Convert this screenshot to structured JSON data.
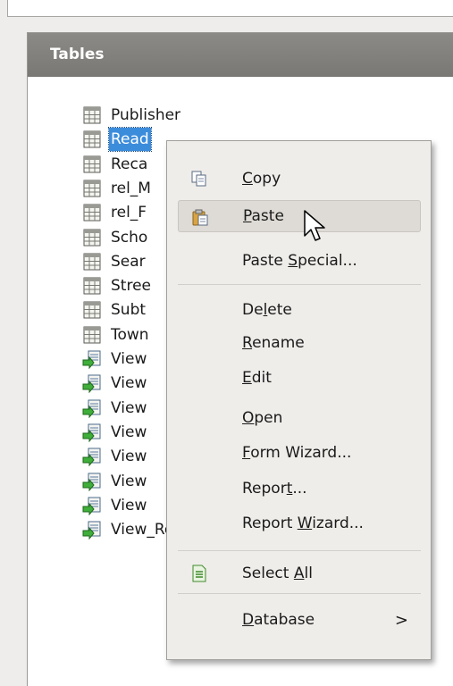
{
  "panel": {
    "title": "Tables"
  },
  "tree_items": [
    {
      "label": "Publisher",
      "kind": "table"
    },
    {
      "label": "Read",
      "kind": "table",
      "selected": true
    },
    {
      "label": "Reca",
      "kind": "table"
    },
    {
      "label": "rel_M",
      "kind": "table"
    },
    {
      "label": "rel_F",
      "kind": "table"
    },
    {
      "label": "Scho",
      "kind": "table"
    },
    {
      "label": "Sear",
      "kind": "table"
    },
    {
      "label": "Stree",
      "kind": "table"
    },
    {
      "label": "Subt",
      "kind": "table"
    },
    {
      "label": "Town",
      "kind": "table"
    },
    {
      "label": "View",
      "kind": "view"
    },
    {
      "label": "View",
      "kind": "view"
    },
    {
      "label": "View",
      "kind": "view"
    },
    {
      "label": "View",
      "kind": "view"
    },
    {
      "label": "View",
      "kind": "view"
    },
    {
      "label": "View",
      "kind": "view"
    },
    {
      "label": "View",
      "kind": "view"
    },
    {
      "label": "View_Recall_current",
      "kind": "view"
    }
  ],
  "context_menu": {
    "items": [
      {
        "pre": "",
        "key": "C",
        "post": "opy",
        "icon": "copy-icon"
      },
      {
        "pre": "",
        "key": "P",
        "post": "aste",
        "icon": "paste-icon",
        "hover": true
      },
      {
        "pre": "Paste ",
        "key": "S",
        "post": "pecial...",
        "icon": ""
      },
      {
        "pre": "De",
        "key": "l",
        "post": "ete",
        "icon": ""
      },
      {
        "pre": "",
        "key": "R",
        "post": "ename",
        "icon": ""
      },
      {
        "pre": "",
        "key": "E",
        "post": "dit",
        "icon": ""
      },
      {
        "pre": "",
        "key": "O",
        "post": "pen",
        "icon": ""
      },
      {
        "pre": "",
        "key": "F",
        "post": "orm Wizard...",
        "icon": ""
      },
      {
        "pre": "Repor",
        "key": "t",
        "post": "...",
        "icon": ""
      },
      {
        "pre": "Report ",
        "key": "W",
        "post": "izard...",
        "icon": ""
      },
      {
        "pre": "Select ",
        "key": "A",
        "post": "ll",
        "icon": "select-all-icon"
      },
      {
        "pre": "",
        "key": "D",
        "post": "atabase",
        "icon": "",
        "submenu": true
      }
    ],
    "submenu_arrow": ">"
  },
  "colors": {
    "selection": "#3c8cdc",
    "header": "#848280",
    "menu_bg": "#efedea"
  }
}
